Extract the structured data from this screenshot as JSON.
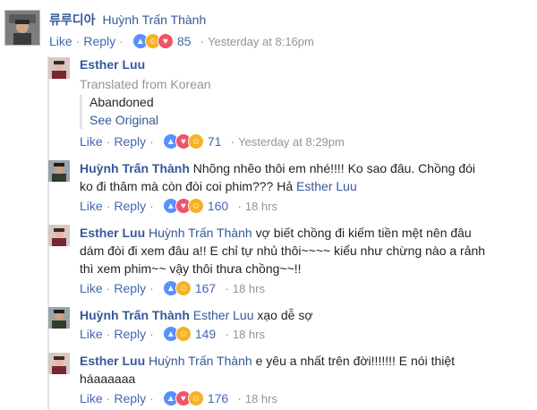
{
  "c1": {
    "author": "류루디아",
    "tag": "Huỳnh Trấn Thành",
    "like": "Like",
    "reply": "Reply",
    "count": "85",
    "time": "Yesterday at 8:16pm"
  },
  "c2": {
    "author": "Esther Luu",
    "translated": "Translated from Korean",
    "quote": "Abandoned",
    "see_original": "See Original",
    "like": "Like",
    "reply": "Reply",
    "count": "71",
    "time": "Yesterday at 8:29pm"
  },
  "c3": {
    "author": "Huỳnh Trấn Thành",
    "text1": "Nhõng nhẽo thôi em nhé!!!! Ko sao đâu. Chồng đói",
    "text2": "ko đi thăm mà còn đòi coi phim??? Hả",
    "tag": "Esther Luu",
    "like": "Like",
    "reply": "Reply",
    "count": "160",
    "time": "18 hrs"
  },
  "c4": {
    "author": "Esther Luu",
    "tag": "Huỳnh Trấn Thành",
    "text1": "vợ biết chồng đi kiếm tiền mệt nên đâu",
    "text2": "dám đòi đi xem đâu a!! E chỉ tự nhủ thôi~~~~ kiểu như chừng nào a rảnh",
    "text3": "thì xem phim~~ vậy thôi thưa chồng~~!!",
    "like": "Like",
    "reply": "Reply",
    "count": "167",
    "time": "18 hrs"
  },
  "c5": {
    "author": "Huỳnh Trấn Thành",
    "tag": "Esther Luu",
    "text": "xạo dễ sợ",
    "like": "Like",
    "reply": "Reply",
    "count": "149",
    "time": "18 hrs"
  },
  "c6": {
    "author": "Esther Luu",
    "tag": "Huỳnh Trấn Thành",
    "text1": "e yêu a nhất trên đời!!!!!!! E nói thiệt",
    "text2": "háaaaaaa",
    "like": "Like",
    "reply": "Reply",
    "count": "176",
    "time": "18 hrs"
  },
  "icons": {
    "like": "thumbs-up-icon",
    "haha": "haha-icon",
    "love": "heart-icon"
  },
  "colors": {
    "link": "#365899",
    "action": "#4267b2",
    "meta": "#90949c",
    "like_reaction": "#5890ff",
    "haha_reaction": "#f7b125",
    "love_reaction": "#f25268"
  }
}
